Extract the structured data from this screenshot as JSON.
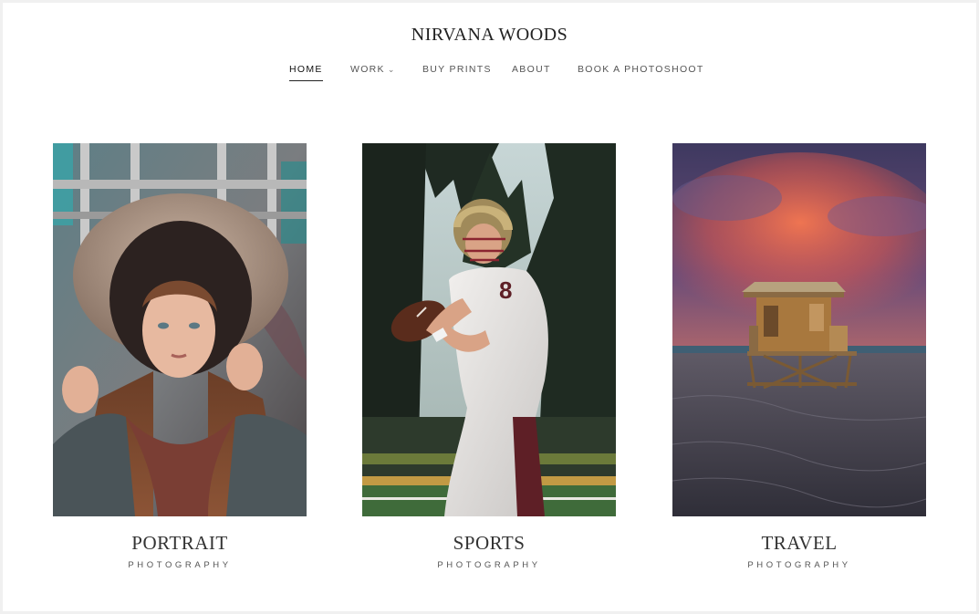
{
  "site": {
    "title": "NIRVANA WOODS"
  },
  "nav": {
    "items": [
      {
        "label": "HOME",
        "active": true
      },
      {
        "label": "WORK",
        "has_dropdown": true
      },
      {
        "label": "BUY PRINTS"
      },
      {
        "label": "ABOUT"
      },
      {
        "label": "BOOK A PHOTOSHOOT"
      }
    ]
  },
  "galleries": [
    {
      "title": "PORTRAIT",
      "subtitle": "PHOTOGRAPHY"
    },
    {
      "title": "SPORTS",
      "subtitle": "PHOTOGRAPHY"
    },
    {
      "title": "TRAVEL",
      "subtitle": "PHOTOGRAPHY"
    }
  ]
}
